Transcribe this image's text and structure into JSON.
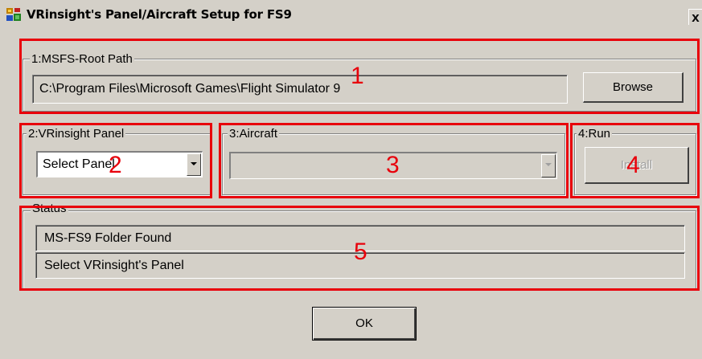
{
  "window": {
    "title": "VRinsight's Panel/Aircraft Setup for FS9",
    "close_glyph": "x"
  },
  "group_root": {
    "label": "1:MSFS-Root Path",
    "path_value": "C:\\Program Files\\Microsoft Games\\Flight Simulator 9",
    "browse_label": "Browse"
  },
  "group_panel": {
    "label": "2:VRinsight Panel",
    "selected": "Select Panel"
  },
  "group_aircraft": {
    "label": "3:Aircraft",
    "selected": ""
  },
  "group_run": {
    "label": "4:Run",
    "install_label": "Install"
  },
  "group_status": {
    "label": "Status",
    "lines": [
      "MS-FS9 Folder Found",
      "Select VRinsight's Panel"
    ]
  },
  "ok_label": "OK",
  "annotations": {
    "color": "#e8000b",
    "numbers": [
      "1",
      "2",
      "3",
      "4",
      "5"
    ]
  },
  "icons": {
    "app": "app-icon",
    "dropdown": "dropdown-arrow-icon"
  }
}
